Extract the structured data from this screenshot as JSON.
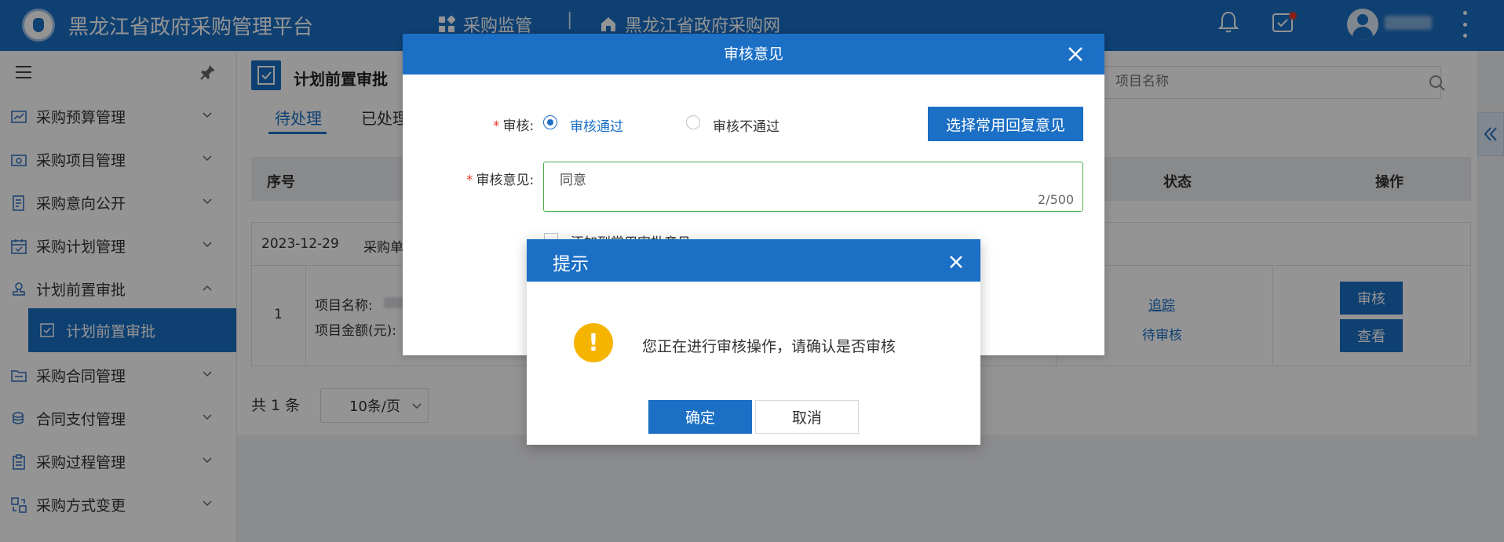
{
  "header": {
    "app_title": "黑龙江省政府采购管理平台",
    "nav_monitor": "采购监管",
    "nav_separator": "|",
    "nav_portal": "黑龙江省政府采购网",
    "icons": [
      "logo-emblem",
      "grid-icon",
      "home-icon",
      "bell-icon",
      "task-icon",
      "avatar",
      "more-icon"
    ]
  },
  "sidebar": {
    "items": [
      {
        "label": "采购预算管理",
        "icon": "chart-icon"
      },
      {
        "label": "采购项目管理",
        "icon": "folder-icon"
      },
      {
        "label": "采购意向公开",
        "icon": "document-icon"
      },
      {
        "label": "采购计划管理",
        "icon": "calendar-icon"
      },
      {
        "label": "计划前置审批",
        "icon": "stamp-icon",
        "expanded": true
      },
      {
        "label": "采购合同管理",
        "icon": "contract-icon"
      },
      {
        "label": "合同支付管理",
        "icon": "coins-icon"
      },
      {
        "label": "采购过程管理",
        "icon": "clipboard-icon"
      },
      {
        "label": "采购方式变更",
        "icon": "switch-icon"
      }
    ],
    "active_sub": "计划前置审批"
  },
  "page": {
    "title": "计划前置审批",
    "tabs": [
      "待处理",
      "已处理"
    ],
    "search_placeholder": "项目名称",
    "table_headers": {
      "index": "序号",
      "status": "状态",
      "actions": "操作"
    },
    "group_row": {
      "date": "2023-12-29",
      "unit_label": "采购单"
    },
    "row": {
      "index": "1",
      "project_name_label": "项目名称:",
      "project_amount_label": "项目金额(元):",
      "trace_link": "追踪",
      "status": "待审核",
      "btn_review": "审核",
      "btn_view": "查看"
    },
    "pager": {
      "total": "共 1 条",
      "page_size": "10条/页"
    }
  },
  "review_dialog": {
    "title": "审核意见",
    "audit_label": "审核:",
    "opt_pass": "审核通过",
    "opt_fail": "审核不通过",
    "selected": "审核通过",
    "choose_common_btn": "选择常用回复意见",
    "opinion_label": "审核意见:",
    "opinion_value": "同意",
    "counter": "2/500",
    "checkbox_label": "添加到常用审批意见"
  },
  "confirm_dialog": {
    "title": "提示",
    "message": "您正在进行审核操作，请确认是否审核",
    "ok": "确定",
    "cancel": "取消"
  },
  "colors": {
    "primary": "#1b6fc5",
    "warning": "#f5b400",
    "badge": "#e63a2e"
  }
}
